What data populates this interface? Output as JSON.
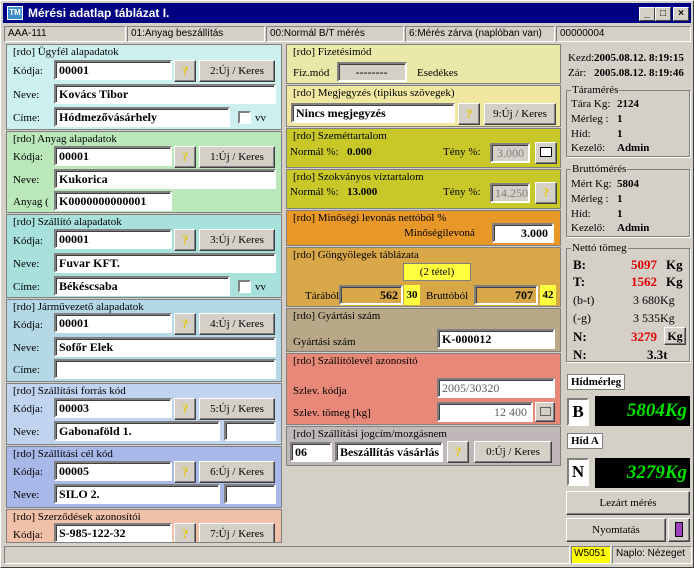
{
  "window": {
    "title": "Mérési adatlap táblázat I.",
    "icon_label": "TM",
    "min": "_",
    "max": "□",
    "close": "×"
  },
  "statusbar": {
    "s1": "AAA-111",
    "s2": "01:Anyag beszállítás",
    "s3": "00:Normál B/T mérés",
    "s4": "6:Mérés zárva (naplóban van)",
    "s5": "00000004"
  },
  "ugyfel": {
    "legend": "[rdo] Ügyfél alapadatok",
    "kod_label": "Kódja:",
    "kod": "00001",
    "q": "?",
    "btn": "2:Új / Keres",
    "nev_label": "Neve:",
    "nev": "Kovács Tibor",
    "cim_label": "Címe:",
    "cim": "Hódmezővásárhely",
    "vv": "vv"
  },
  "anyag": {
    "legend": "[rdo] Anyag alapadatok",
    "kod_label": "Kódja:",
    "kod": "00001",
    "q": "?",
    "btn": "1:Új / Keres",
    "nev_label": "Neve:",
    "nev": "Kukorica",
    "anyag_label": "Anyag (",
    "anyag": "K0000000000001"
  },
  "szallito": {
    "legend": "[rdo] Szállító alapadatok",
    "kod_label": "Kódja:",
    "kod": "00001",
    "q": "?",
    "btn": "3:Új / Keres",
    "nev_label": "Neve:",
    "nev": "Fuvar KFT.",
    "cim_label": "Címe:",
    "cim": "Békéscsaba",
    "vv": "vv"
  },
  "jarmu": {
    "legend": "[rdo] Járművezető alapadatok",
    "kod_label": "Kódja:",
    "kod": "00001",
    "q": "?",
    "btn": "4:Új / Keres",
    "nev_label": "Neve:",
    "nev": "Sofőr Elek",
    "cim_label": "Címe:",
    "cim": ""
  },
  "forras": {
    "legend": "[rdo] Szállítási forrás kód",
    "kod_label": "Kódja:",
    "kod": "00003",
    "q": "?",
    "btn": "5:Új / Keres",
    "nev_label": "Neve:",
    "nev": "Gabonaföld 1."
  },
  "cel": {
    "legend": "[rdo] Szállítási cél kód",
    "kod_label": "Kódja:",
    "kod": "00005",
    "q": "?",
    "btn": "6:Új / Keres",
    "nev_label": "Neve:",
    "nev": "SILO 2."
  },
  "szerzodes": {
    "legend": "[rdo] Szerződések azonosítói",
    "kod_label": "Kódja:",
    "kod": "S-985-122-32",
    "q": "?",
    "btn": "7:Új / Keres"
  },
  "fizetes": {
    "legend": "[rdo] Fizetésimód",
    "mod_label": "Fiz.mód",
    "mod": "--------",
    "esed": "Esedékes"
  },
  "megjegyzes": {
    "legend": "[rdo] Megjegyzés (tipikus szövegek)",
    "value": "Nincs megjegyzés",
    "q": "?",
    "btn": "9:Új / Keres"
  },
  "szemet": {
    "legend": "[rdo] Szeméttartalom",
    "normal_label": "Normál %:",
    "normal": "0.000",
    "teny_label": "Tény %:",
    "teny": "3.000"
  },
  "viz": {
    "legend": "[rdo] Szokványos víztartalom",
    "normal_label": "Normál %:",
    "normal": "13.000",
    "teny_label": "Tény %:",
    "teny": "14.250",
    "q": "?"
  },
  "minoseg": {
    "legend": "[rdo] Minőségi levonás nettóból %",
    "label": "Minőségilevoná",
    "value": "3.000"
  },
  "gongyoleg": {
    "legend": "[rdo] Göngyölegek táblázata",
    "tetel": "(2 tétel)",
    "tara_label": "Tárából",
    "tara": "562",
    "tara_n": "30",
    "brutto_label": "Bruttóból",
    "brutto": "707",
    "brutto_n": "42"
  },
  "gyartasi": {
    "legend": "[rdo] Gyártási szám",
    "label": "Gyártási szám",
    "value": "K-000012"
  },
  "szallitolevel": {
    "legend": "[rdo] Szállítólevél azonosító",
    "kod_label": "Szlev. kódja",
    "kod": "2005/30320",
    "tomeg_label": "Szlev. tömeg [kg]",
    "tomeg": "12 400"
  },
  "jogcim": {
    "legend": "[rdo] Szállítási jogcím/mozgásnem",
    "kod": "06",
    "value": "Beszállítás vásárlás",
    "q": "?",
    "btn": "0:Új / Keres"
  },
  "right": {
    "kezd_label": "Kezd:",
    "kezd": "2005.08.12. 8:19:15",
    "zar_label": "Zár:",
    "zar": "2005.08.12. 8:19:46",
    "tara": {
      "title": "Táramérés",
      "kg_label": "Tára Kg:",
      "kg": "2124",
      "merleg_label": "Mérleg :",
      "merleg": "1",
      "hid_label": "Híd:",
      "hid": "1",
      "kezelo_label": "Kezelő:",
      "kezelo": "Admin"
    },
    "brutto": {
      "title": "Bruttómérés",
      "kg_label": "Mért Kg:",
      "kg": "5804",
      "merleg_label": "Mérleg :",
      "merleg": "1",
      "hid_label": "Híd:",
      "hid": "1",
      "kezelo_label": "Kezelő:",
      "kezelo": "Admin"
    },
    "netto": {
      "title": "Nettó tömeg",
      "b_label": "B:",
      "b": "5097",
      "t_label": "T:",
      "t": "1562",
      "kg": "Kg",
      "bt_label": "(b-t)",
      "bt": "3 680Kg",
      "g_label": "(-g)",
      "g": "3 535Kg",
      "n_label": "N:",
      "n": "3279",
      "n_kg": "Kg",
      "n2_label": "N:",
      "n2": "3.3t"
    },
    "hidmerleg": "Hídmérleg",
    "b_letter": "B",
    "b_lcd": "5804Kg",
    "hida": "Híd A",
    "n_letter": "N",
    "n_lcd": "3279Kg",
    "lezart": "Lezárt mérés",
    "nyomtatas": "Nyomtatás"
  },
  "bottom": {
    "w": "W5051",
    "naplo": "Naplo: Nézeget"
  },
  "colors": {
    "ugyfel": "#ccf0ee",
    "anyag": "#bbe8bb",
    "szallito": "#a8e0dc",
    "jarmu": "#b4d8e6",
    "forras": "#c0d4f0",
    "cel": "#a8b8e8",
    "szerzodes": "#f0c0a8",
    "fizetes": "#e8e8a8",
    "megjegyzes": "#f0e8a0",
    "szemet": "#c8c828",
    "minoseg": "#e89828",
    "gongyoleg": "#d8a848",
    "gyartasi": "#b8a888",
    "szallitolevel": "#e88878",
    "jogcim": "#c0b8b8"
  }
}
